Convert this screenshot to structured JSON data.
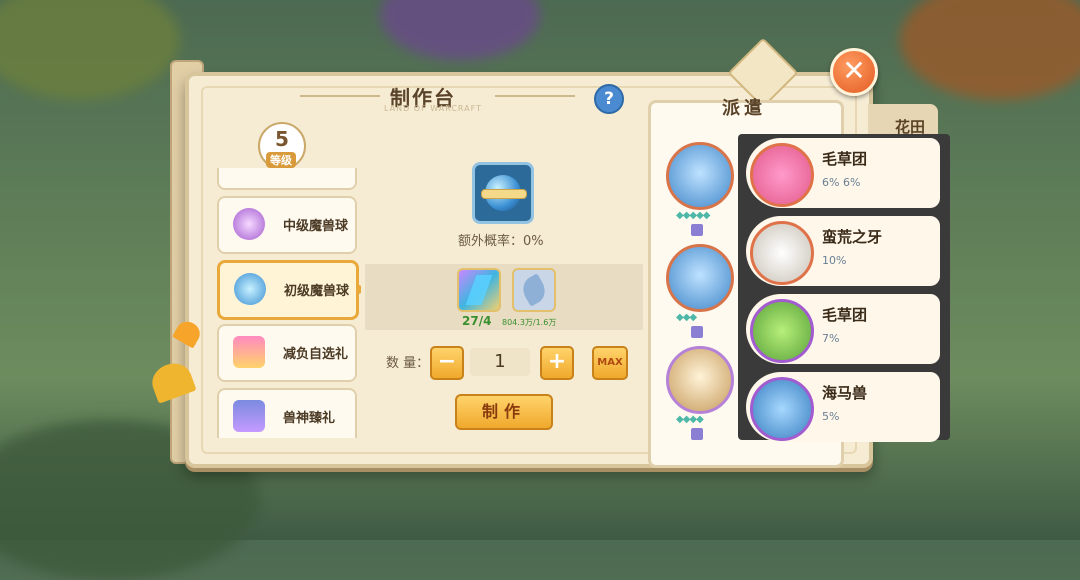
{
  "window": {
    "title": "制作台",
    "subtitle": "LAND OF WARCRAFT",
    "help": "?",
    "close": "✕"
  },
  "level": {
    "value": "5",
    "label": "等级"
  },
  "recipes": [
    {
      "name": "中级魔兽球",
      "selected": false,
      "icon": "mid-orb-icon"
    },
    {
      "name": "初级魔兽球",
      "selected": true,
      "icon": "basic-orb-icon"
    },
    {
      "name": "减负自选礼",
      "selected": false,
      "icon": "gift-box-icon"
    },
    {
      "name": "兽神臻礼",
      "selected": false,
      "icon": "treasure-chest-icon"
    }
  ],
  "product": {
    "extra_chance_label": "额外概率：0%"
  },
  "materials": [
    {
      "icon": "crystal-icon",
      "count": "27/4"
    },
    {
      "icon": "leaf-icon",
      "count": "804.3万/1.6万"
    }
  ],
  "quantity": {
    "label": "数 量：",
    "value": "1",
    "minus": "−",
    "plus": "+",
    "max": "MAX"
  },
  "make_button": "制作",
  "dispatch": {
    "title": "派遣"
  },
  "beasts": [
    {
      "name": "毛草团",
      "stats": "6%    6%"
    },
    {
      "name": "蛮荒之牙",
      "stats": "10%"
    },
    {
      "name": "毛草团",
      "stats": "7%"
    },
    {
      "name": "海马兽",
      "stats": "5%"
    }
  ],
  "side_tab": {
    "label": "花田"
  },
  "colors": {
    "accent": "#f0a92c",
    "panel": "#f6ecd4",
    "success": "#3a8f2e"
  }
}
